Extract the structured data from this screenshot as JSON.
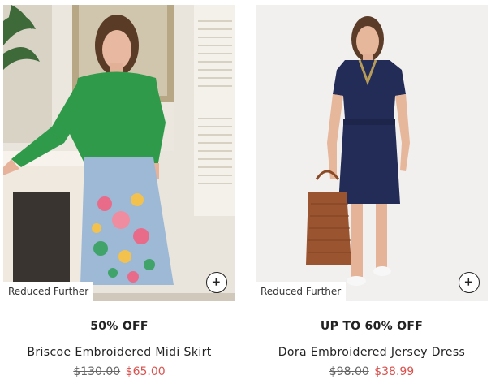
{
  "products": [
    {
      "badge": "Reduced Further",
      "promo": "50% OFF",
      "name": "Briscoe Embroidered Midi Skirt",
      "was_price": "$130.00",
      "now_price": "$65.00",
      "image_icon": "product-photo-skirt"
    },
    {
      "badge": "Reduced Further",
      "promo": "UP TO 60% OFF",
      "name": "Dora Embroidered Jersey Dress",
      "was_price": "$98.00",
      "now_price": "$38.99",
      "image_icon": "product-photo-dress"
    }
  ],
  "colors": {
    "sale_price": "#d9534f",
    "text": "#222222",
    "strikethrough": "#666666"
  },
  "icons": {
    "add": "plus-circle-icon"
  }
}
